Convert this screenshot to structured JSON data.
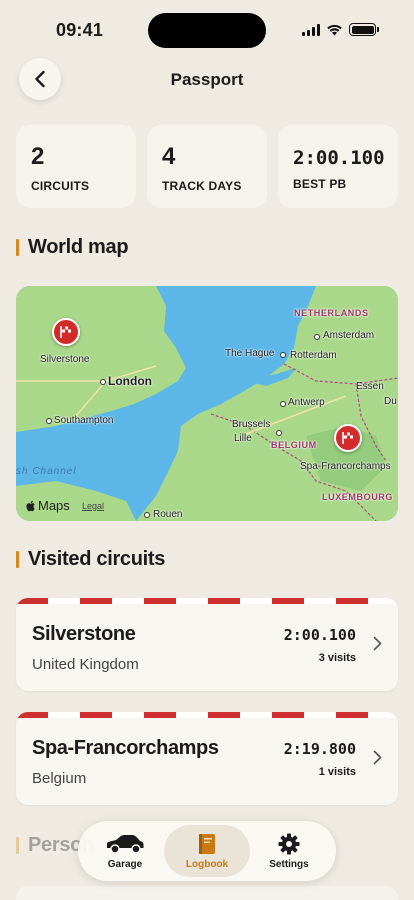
{
  "status_bar": {
    "time": "09:41"
  },
  "header": {
    "title": "Passport"
  },
  "stats": [
    {
      "value": "2",
      "label": "CIRCUITS"
    },
    {
      "value": "4",
      "label": "TRACK DAYS"
    },
    {
      "value": "2:00.100",
      "label": "BEST PB"
    }
  ],
  "sections": {
    "world_map": "World map",
    "visited_circuits": "Visited circuits",
    "personal": "Person"
  },
  "map": {
    "labels": {
      "netherlands": "NETHERLANDS",
      "amsterdam": "Amsterdam",
      "the_hague": "The Hague",
      "rotterdam": "Rotterdam",
      "silverstone": "Silverstone",
      "london": "London",
      "southampton": "Southampton",
      "essen": "Essen",
      "antwerp": "Antwerp",
      "brussels": "Brussels",
      "lille": "Lille",
      "belgium": "BELGIUM",
      "spa": "Spa-Francorchamps",
      "luxembourg": "LUXEMBOURG",
      "channel": "sh Channel",
      "rouen": "Rouen",
      "du": "Du"
    },
    "brand": "Maps",
    "legal": "Legal"
  },
  "circuits": [
    {
      "name": "Silverstone",
      "country": "United Kingdom",
      "best_time": "2:00.100",
      "visits": "3 visits"
    },
    {
      "name": "Spa-Francorchamps",
      "country": "Belgium",
      "best_time": "2:19.800",
      "visits": "1 visits"
    }
  ],
  "tabs": [
    {
      "label": "Garage",
      "icon": "car-icon"
    },
    {
      "label": "Logbook",
      "icon": "book-icon",
      "active": true
    },
    {
      "label": "Settings",
      "icon": "gear-icon"
    }
  ],
  "colors": {
    "accent": "#d68a19",
    "pin": "#d42a2a",
    "stripe": "#ce3030",
    "background": "#efebe3"
  }
}
